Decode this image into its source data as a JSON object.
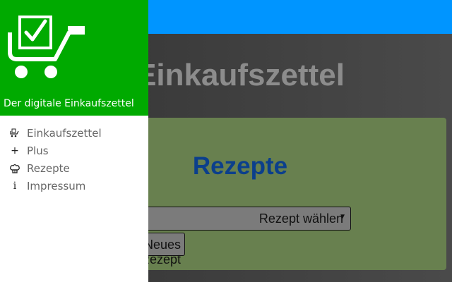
{
  "header": {
    "bar_color": "#0095ff"
  },
  "page": {
    "title": "Einkaufszettel",
    "card": {
      "heading": "Rezepte",
      "select_value": "Rezept wählen",
      "button_label": "Neues Rezept"
    }
  },
  "drawer": {
    "header_color": "#00aa00",
    "logo_icon": "shopping-cart-check-icon",
    "tagline": "Der digitale Einkaufszettel",
    "items": [
      {
        "label": "Einkaufszettel",
        "icon": "cart-icon"
      },
      {
        "label": "Plus",
        "icon": "plus-icon"
      },
      {
        "label": "Rezepte",
        "icon": "chef-hat-icon"
      },
      {
        "label": "Impressum",
        "icon": "info-icon"
      }
    ]
  }
}
